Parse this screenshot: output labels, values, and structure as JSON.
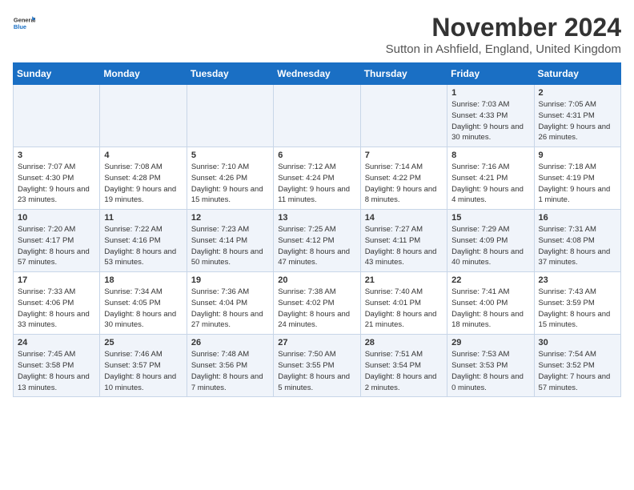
{
  "logo": {
    "general": "General",
    "blue": "Blue"
  },
  "title": "November 2024",
  "subtitle": "Sutton in Ashfield, England, United Kingdom",
  "weekdays": [
    "Sunday",
    "Monday",
    "Tuesday",
    "Wednesday",
    "Thursday",
    "Friday",
    "Saturday"
  ],
  "weeks": [
    [
      {
        "day": "",
        "info": ""
      },
      {
        "day": "",
        "info": ""
      },
      {
        "day": "",
        "info": ""
      },
      {
        "day": "",
        "info": ""
      },
      {
        "day": "",
        "info": ""
      },
      {
        "day": "1",
        "info": "Sunrise: 7:03 AM\nSunset: 4:33 PM\nDaylight: 9 hours and 30 minutes."
      },
      {
        "day": "2",
        "info": "Sunrise: 7:05 AM\nSunset: 4:31 PM\nDaylight: 9 hours and 26 minutes."
      }
    ],
    [
      {
        "day": "3",
        "info": "Sunrise: 7:07 AM\nSunset: 4:30 PM\nDaylight: 9 hours and 23 minutes."
      },
      {
        "day": "4",
        "info": "Sunrise: 7:08 AM\nSunset: 4:28 PM\nDaylight: 9 hours and 19 minutes."
      },
      {
        "day": "5",
        "info": "Sunrise: 7:10 AM\nSunset: 4:26 PM\nDaylight: 9 hours and 15 minutes."
      },
      {
        "day": "6",
        "info": "Sunrise: 7:12 AM\nSunset: 4:24 PM\nDaylight: 9 hours and 11 minutes."
      },
      {
        "day": "7",
        "info": "Sunrise: 7:14 AM\nSunset: 4:22 PM\nDaylight: 9 hours and 8 minutes."
      },
      {
        "day": "8",
        "info": "Sunrise: 7:16 AM\nSunset: 4:21 PM\nDaylight: 9 hours and 4 minutes."
      },
      {
        "day": "9",
        "info": "Sunrise: 7:18 AM\nSunset: 4:19 PM\nDaylight: 9 hours and 1 minute."
      }
    ],
    [
      {
        "day": "10",
        "info": "Sunrise: 7:20 AM\nSunset: 4:17 PM\nDaylight: 8 hours and 57 minutes."
      },
      {
        "day": "11",
        "info": "Sunrise: 7:22 AM\nSunset: 4:16 PM\nDaylight: 8 hours and 53 minutes."
      },
      {
        "day": "12",
        "info": "Sunrise: 7:23 AM\nSunset: 4:14 PM\nDaylight: 8 hours and 50 minutes."
      },
      {
        "day": "13",
        "info": "Sunrise: 7:25 AM\nSunset: 4:12 PM\nDaylight: 8 hours and 47 minutes."
      },
      {
        "day": "14",
        "info": "Sunrise: 7:27 AM\nSunset: 4:11 PM\nDaylight: 8 hours and 43 minutes."
      },
      {
        "day": "15",
        "info": "Sunrise: 7:29 AM\nSunset: 4:09 PM\nDaylight: 8 hours and 40 minutes."
      },
      {
        "day": "16",
        "info": "Sunrise: 7:31 AM\nSunset: 4:08 PM\nDaylight: 8 hours and 37 minutes."
      }
    ],
    [
      {
        "day": "17",
        "info": "Sunrise: 7:33 AM\nSunset: 4:06 PM\nDaylight: 8 hours and 33 minutes."
      },
      {
        "day": "18",
        "info": "Sunrise: 7:34 AM\nSunset: 4:05 PM\nDaylight: 8 hours and 30 minutes."
      },
      {
        "day": "19",
        "info": "Sunrise: 7:36 AM\nSunset: 4:04 PM\nDaylight: 8 hours and 27 minutes."
      },
      {
        "day": "20",
        "info": "Sunrise: 7:38 AM\nSunset: 4:02 PM\nDaylight: 8 hours and 24 minutes."
      },
      {
        "day": "21",
        "info": "Sunrise: 7:40 AM\nSunset: 4:01 PM\nDaylight: 8 hours and 21 minutes."
      },
      {
        "day": "22",
        "info": "Sunrise: 7:41 AM\nSunset: 4:00 PM\nDaylight: 8 hours and 18 minutes."
      },
      {
        "day": "23",
        "info": "Sunrise: 7:43 AM\nSunset: 3:59 PM\nDaylight: 8 hours and 15 minutes."
      }
    ],
    [
      {
        "day": "24",
        "info": "Sunrise: 7:45 AM\nSunset: 3:58 PM\nDaylight: 8 hours and 13 minutes."
      },
      {
        "day": "25",
        "info": "Sunrise: 7:46 AM\nSunset: 3:57 PM\nDaylight: 8 hours and 10 minutes."
      },
      {
        "day": "26",
        "info": "Sunrise: 7:48 AM\nSunset: 3:56 PM\nDaylight: 8 hours and 7 minutes."
      },
      {
        "day": "27",
        "info": "Sunrise: 7:50 AM\nSunset: 3:55 PM\nDaylight: 8 hours and 5 minutes."
      },
      {
        "day": "28",
        "info": "Sunrise: 7:51 AM\nSunset: 3:54 PM\nDaylight: 8 hours and 2 minutes."
      },
      {
        "day": "29",
        "info": "Sunrise: 7:53 AM\nSunset: 3:53 PM\nDaylight: 8 hours and 0 minutes."
      },
      {
        "day": "30",
        "info": "Sunrise: 7:54 AM\nSunset: 3:52 PM\nDaylight: 7 hours and 57 minutes."
      }
    ]
  ]
}
